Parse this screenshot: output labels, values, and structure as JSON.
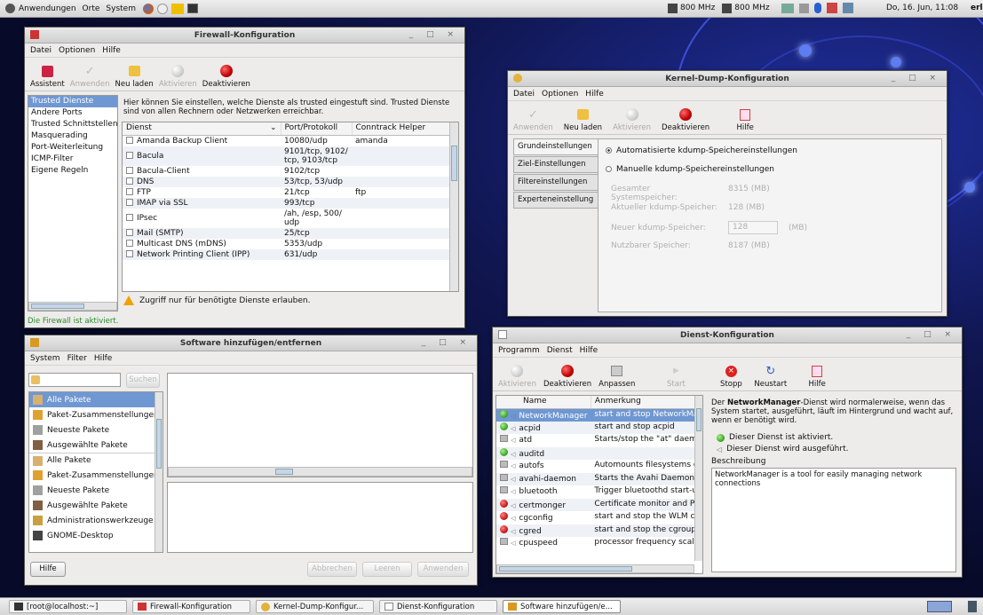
{
  "top_panel": {
    "menus": [
      "Anwendungen",
      "Orte",
      "System"
    ],
    "cpu1": "800 MHz",
    "cpu2": "800 MHz",
    "clock": "Do, 16. Jun, 11:08",
    "user": "erl"
  },
  "firewall": {
    "title": "Firewall-Konfiguration",
    "menu": [
      "Datei",
      "Optionen",
      "Hilfe"
    ],
    "toolbar": [
      "Assistent",
      "Anwenden",
      "Neu laden",
      "Aktivieren",
      "Deaktivieren"
    ],
    "sidebar": [
      "Trusted Dienste",
      "Andere Ports",
      "Trusted Schnittstellen",
      "Masquerading",
      "Port-Weiterleitung",
      "ICMP-Filter",
      "Eigene Regeln"
    ],
    "description": "Hier können Sie einstellen, welche Dienste als trusted eingestuft sind. Trusted Dienste sind von allen Rechnern oder Netzwerken erreichbar.",
    "columns": [
      "Dienst",
      "Port/Protokoll",
      "Conntrack Helper"
    ],
    "rows": [
      {
        "name": "Amanda Backup Client",
        "port": "10080/udp",
        "helper": "amanda"
      },
      {
        "name": "Bacula",
        "port": "9101/tcp, 9102/ tcp, 9103/tcp",
        "helper": ""
      },
      {
        "name": "Bacula-Client",
        "port": "9102/tcp",
        "helper": ""
      },
      {
        "name": "DNS",
        "port": "53/tcp, 53/udp",
        "helper": ""
      },
      {
        "name": "FTP",
        "port": "21/tcp",
        "helper": "ftp"
      },
      {
        "name": "IMAP via SSL",
        "port": "993/tcp",
        "helper": ""
      },
      {
        "name": "IPsec",
        "port": "/ah, /esp, 500/ udp",
        "helper": ""
      },
      {
        "name": "Mail (SMTP)",
        "port": "25/tcp",
        "helper": ""
      },
      {
        "name": "Multicast DNS (mDNS)",
        "port": "5353/udp",
        "helper": ""
      },
      {
        "name": "Network Printing Client (IPP)",
        "port": "631/udp",
        "helper": ""
      }
    ],
    "warning": "Zugriff nur für benötigte Dienste erlauben.",
    "status": "Die Firewall ist aktiviert."
  },
  "kdump": {
    "title": "Kernel-Dump-Konfiguration",
    "menu": [
      "Datei",
      "Optionen",
      "Hilfe"
    ],
    "toolbar": [
      "Anwenden",
      "Neu laden",
      "Aktivieren",
      "Deaktivieren",
      "Hilfe"
    ],
    "tabs": [
      "Grundeinstellungen",
      "Ziel-Einstellungen",
      "Filtereinstellungen",
      "Experteneinstellung"
    ],
    "radio_auto": "Automatisierte kdump-Speichereinstellungen",
    "radio_manual": "Manuelle kdump-Speichereinstellungen",
    "fields": [
      {
        "label": "Gesamter Systemspeicher:",
        "value": "8315 (MB)"
      },
      {
        "label": "Aktueller kdump-Speicher:",
        "value": "128 (MB)"
      },
      {
        "label": "Neuer kdump-Speicher:",
        "value": "128",
        "unit": "(MB)"
      },
      {
        "label": "Nutzbarer Speicher:",
        "value": "8187 (MB)"
      }
    ]
  },
  "software": {
    "title": "Software hinzufügen/entfernen",
    "menu": [
      "System",
      "Filter",
      "Hilfe"
    ],
    "search_button": "Suchen",
    "search_value": "",
    "groups": [
      "Alle Pakete",
      "Paket-Zusammenstellungen",
      "Neueste Pakete",
      "Ausgewählte Pakete",
      "Alle Pakete",
      "Paket-Zusammenstellungen",
      "Neueste Pakete",
      "Ausgewählte Pakete",
      "Administrationswerkzeuge",
      "GNOME-Desktop"
    ],
    "buttons": {
      "help": "Hilfe",
      "cancel": "Abbrechen",
      "clear": "Leeren",
      "apply": "Anwenden"
    }
  },
  "services": {
    "title": "Dienst-Konfiguration",
    "menu": [
      "Programm",
      "Dienst",
      "Hilfe"
    ],
    "toolbar": [
      "Aktivieren",
      "Deaktivieren",
      "Anpassen",
      "Start",
      "Stopp",
      "Neustart",
      "Hilfe"
    ],
    "columns": [
      "Name",
      "Anmerkung"
    ],
    "rows": [
      {
        "name": "NetworkManager",
        "note": "start and stop NetworkMa",
        "state": "green"
      },
      {
        "name": "acpid",
        "note": "start and stop acpid",
        "state": "green"
      },
      {
        "name": "atd",
        "note": "Starts/stop the \"at\" daemc",
        "state": "grey"
      },
      {
        "name": "auditd",
        "note": "",
        "state": "green"
      },
      {
        "name": "autofs",
        "note": "Automounts filesystems o",
        "state": "grey"
      },
      {
        "name": "avahi-daemon",
        "note": "Starts the Avahi Daemon",
        "state": "grey"
      },
      {
        "name": "bluetooth",
        "note": "Trigger bluetoothd start-u",
        "state": "grey"
      },
      {
        "name": "certmonger",
        "note": "Certificate monitor and PK",
        "state": "red"
      },
      {
        "name": "cgconfig",
        "note": "start and stop the WLM co",
        "state": "red"
      },
      {
        "name": "cgred",
        "note": "start and stop the cgroups",
        "state": "red"
      },
      {
        "name": "cpuspeed",
        "note": "processor frequency scalir",
        "state": "grey"
      }
    ],
    "detail_pre": "Der ",
    "detail_bold": "NetworkManager",
    "detail_post": "-Dienst wird normalerweise, wenn das System startet, ausgeführt, läuft im Hintergrund und wacht auf, wenn er benötigt wird.",
    "status_enabled": "Dieser Dienst ist aktiviert.",
    "status_running": "Dieser Dienst wird ausgeführt.",
    "desc_label": "Beschreibung",
    "desc_text": "NetworkManager is a tool for easily managing network connections"
  },
  "taskbar": [
    "[root@localhost:~]",
    "Firewall-Konfiguration",
    "Kernel-Dump-Konfigur...",
    "Dienst-Konfiguration",
    "Software hinzufügen/e..."
  ]
}
